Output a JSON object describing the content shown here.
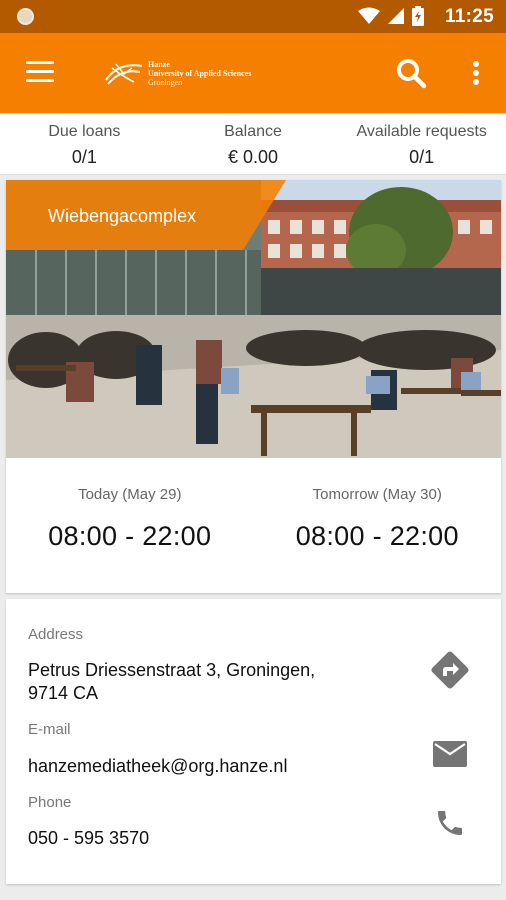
{
  "statusbar": {
    "time": "11:25"
  },
  "appbar": {
    "logo_text": [
      "Hanze",
      "University of Applied Sciences",
      "Groningen"
    ]
  },
  "stats": [
    {
      "label": "Due loans",
      "value": "0/1"
    },
    {
      "label": "Balance",
      "value": "€ 0.00"
    },
    {
      "label": "Available requests",
      "value": "0/1"
    }
  ],
  "location": {
    "name": "Wiebengacomplex",
    "today": {
      "label": "Today (May 29)",
      "hours": "08:00 - 22:00"
    },
    "tomorrow": {
      "label": "Tomorrow (May 30)",
      "hours": "08:00 - 22:00"
    }
  },
  "contact": {
    "address_label": "Address",
    "address_line1": "Petrus Driessenstraat 3, Groningen,",
    "address_line2": "9714 CA",
    "email_label": "E-mail",
    "email": "hanzemediatheek@org.hanze.nl",
    "phone_label": "Phone",
    "phone": "050 - 595 3570"
  },
  "colors": {
    "primary": "#f57f00",
    "statusbar": "#b35a00",
    "icon_gray": "#757575"
  }
}
